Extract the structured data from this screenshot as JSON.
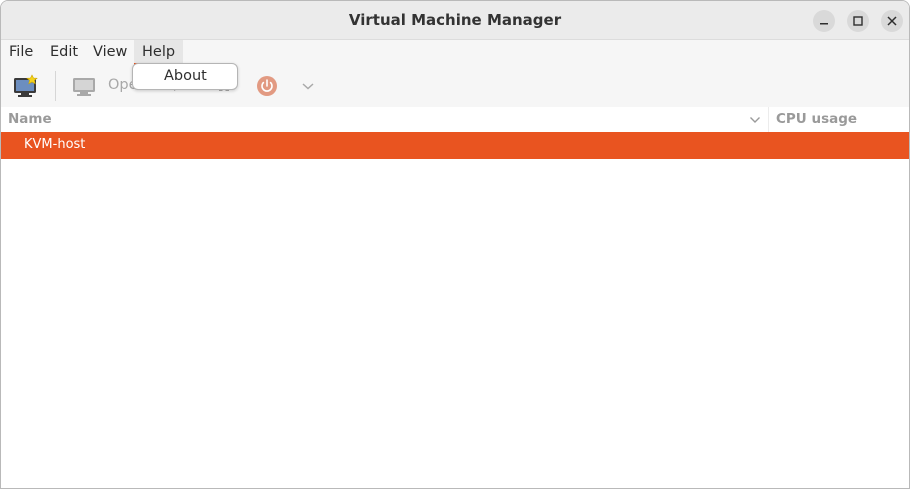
{
  "window": {
    "title": "Virtual Machine Manager"
  },
  "menubar": {
    "items": [
      {
        "label": "File"
      },
      {
        "label": "Edit"
      },
      {
        "label": "View"
      },
      {
        "label": "Help",
        "state": "open"
      }
    ]
  },
  "help_menu": {
    "items": [
      {
        "label": "About"
      }
    ]
  },
  "toolbar": {
    "new_vm_icon": "new-vm-icon",
    "open_label": "Open",
    "run_icon": "play-icon",
    "pause_icon": "pause-icon",
    "shutdown_icon": "power-icon",
    "shutdown_menu_icon": "chevron-down-icon"
  },
  "list": {
    "columns": [
      {
        "label": "Name"
      },
      {
        "label": "CPU usage"
      }
    ],
    "rows": [
      {
        "name": "KVM-host",
        "selected": true
      }
    ]
  },
  "colors": {
    "accent": "#e95420",
    "titlebar_bg": "#ebebeb",
    "toolbar_bg": "#f6f6f6"
  }
}
